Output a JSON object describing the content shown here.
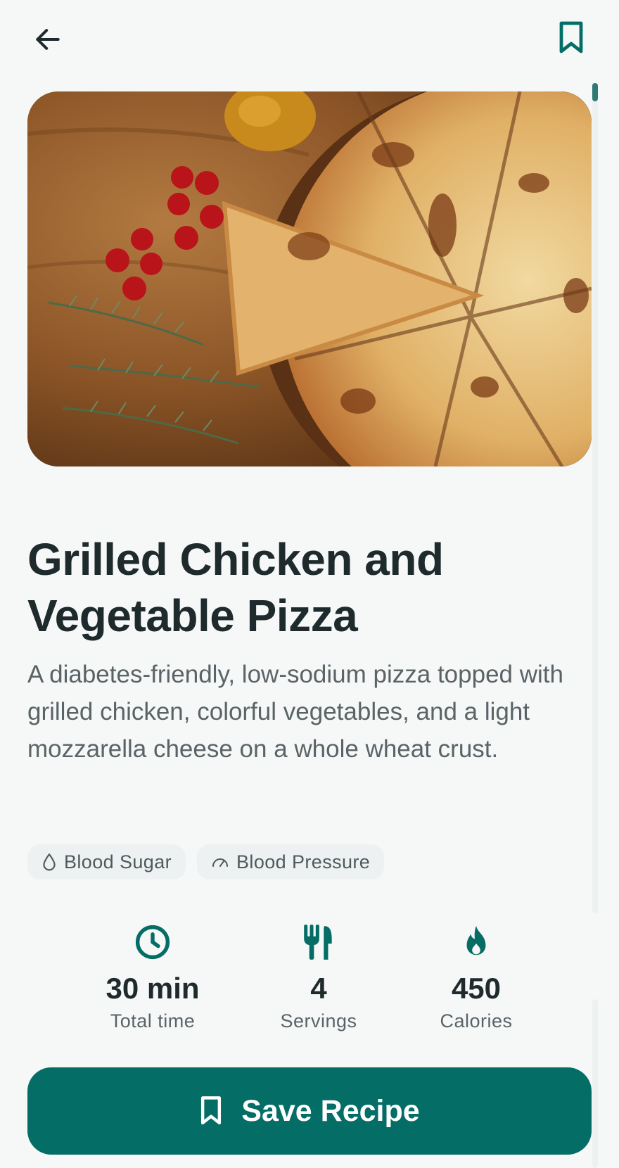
{
  "header": {
    "back_icon": "arrow-left-icon",
    "bookmark_icon": "bookmark-outline-icon",
    "accent_color": "#046d65"
  },
  "recipe": {
    "image_alt": "Pizza on wooden board with cherry tomatoes and rosemary",
    "title": "Grilled Chicken and Vegetable Pizza",
    "description": "A diabetes-friendly, low-sodium pizza topped with grilled chicken, colorful vegetables, and a light mozzarella cheese on a whole wheat crust.",
    "tags": [
      {
        "icon": "droplet-icon",
        "label": "Blood Sugar"
      },
      {
        "icon": "gauge-icon",
        "label": "Blood Pressure"
      }
    ],
    "stats": [
      {
        "icon": "clock-icon",
        "value": "30 min",
        "label": "Total time"
      },
      {
        "icon": "utensils-icon",
        "value": "4",
        "label": "Servings"
      },
      {
        "icon": "flame-icon",
        "value": "450",
        "label": "Calories"
      }
    ]
  },
  "actions": {
    "save_label": "Save Recipe",
    "save_icon": "bookmark-outline-icon"
  }
}
